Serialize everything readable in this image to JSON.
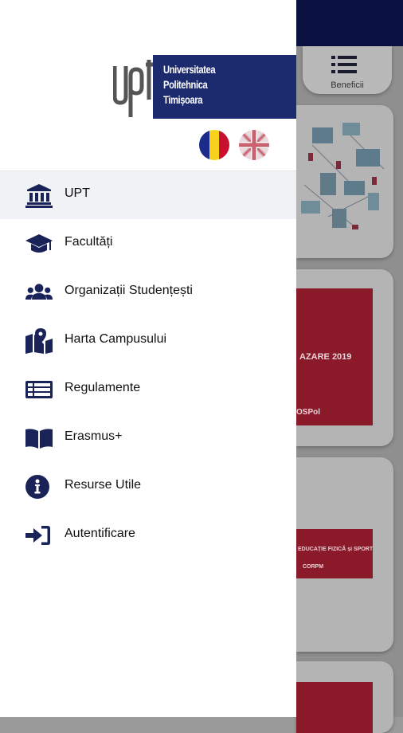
{
  "background": {
    "benefit_label": "Beneficii",
    "card2_text": "AZARE 2019",
    "card2_logo": "OSPol",
    "card3_text": "EDUCAȚIE FIZICĂ și SPORT",
    "card3_sub": "CORPM"
  },
  "drawer": {
    "logo_upt": "UPT",
    "logo_lines": [
      "Universitatea",
      "Politehnica",
      "Timișoara"
    ],
    "languages": [
      {
        "name": "romanian-flag-icon"
      },
      {
        "name": "english-flag-icon"
      }
    ],
    "menu": [
      {
        "label": "UPT",
        "icon": "institution-icon"
      },
      {
        "label": "Facultăți",
        "icon": "graduation-cap-icon"
      },
      {
        "label": "Organizații Studențești",
        "icon": "users-icon"
      },
      {
        "label": "Harta Campusului",
        "icon": "map-marker-icon"
      },
      {
        "label": "Regulamente",
        "icon": "list-document-icon"
      },
      {
        "label": "Erasmus+",
        "icon": "open-book-icon"
      },
      {
        "label": "Resurse Utile",
        "icon": "info-icon"
      },
      {
        "label": "Autentificare",
        "icon": "sign-in-icon"
      }
    ]
  },
  "colors": {
    "brand_navy": "#1c2a6e",
    "icon_navy": "#1a2358",
    "active_bg": "#f1f2f5"
  }
}
